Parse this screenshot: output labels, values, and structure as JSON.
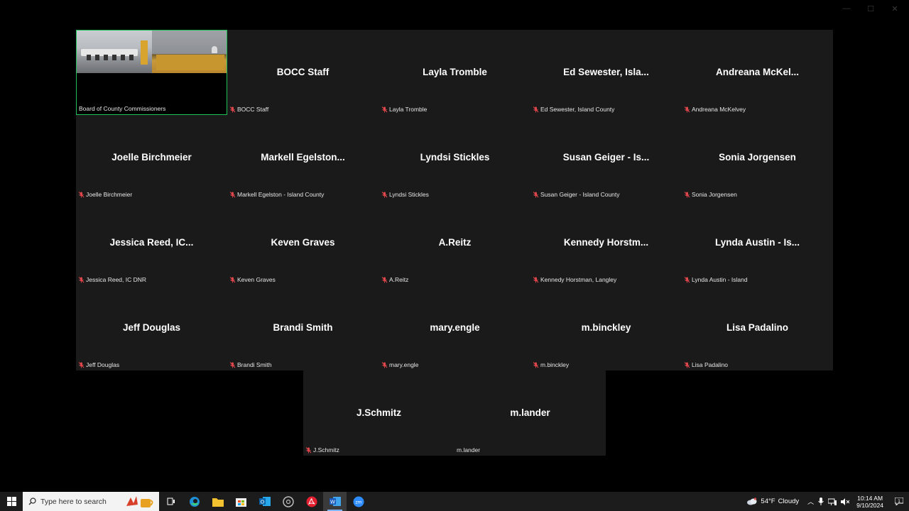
{
  "gallery": {
    "tiles": [
      {
        "name": "",
        "label": "Board of County Commissioners",
        "muted": false,
        "video": true
      },
      {
        "name": "BOCC Staff",
        "label": "BOCC Staff",
        "muted": true
      },
      {
        "name": "Layla Tromble",
        "label": "Layla Tromble",
        "muted": true
      },
      {
        "name": "Ed Sewester, Isla...",
        "label": "Ed Sewester, Island County",
        "muted": true
      },
      {
        "name": "Andreana McKel...",
        "label": "Andreana McKelvey",
        "muted": true
      },
      {
        "name": "Joelle Birchmeier",
        "label": "Joelle Birchmeier",
        "muted": true
      },
      {
        "name": "Markell Egelston...",
        "label": "Markell Egelston - Island County",
        "muted": true
      },
      {
        "name": "Lyndsi Stickles",
        "label": "Lyndsi Stickles",
        "muted": true
      },
      {
        "name": "Susan Geiger - Is...",
        "label": "Susan Geiger - Island County",
        "muted": true
      },
      {
        "name": "Sonia Jorgensen",
        "label": "Sonia Jorgensen",
        "muted": true
      },
      {
        "name": "Jessica Reed, IC...",
        "label": "Jessica Reed, IC DNR",
        "muted": true
      },
      {
        "name": "Keven Graves",
        "label": "Keven Graves",
        "muted": true
      },
      {
        "name": "A.Reitz",
        "label": "A.Reitz",
        "muted": true
      },
      {
        "name": "Kennedy Horstm...",
        "label": "Kennedy Horstman, Langley",
        "muted": true
      },
      {
        "name": "Lynda Austin - Is...",
        "label": "Lynda Austin - Island",
        "muted": true
      },
      {
        "name": "Jeff Douglas",
        "label": "Jeff Douglas",
        "muted": true
      },
      {
        "name": "Brandi Smith",
        "label": "Brandi Smith",
        "muted": true
      },
      {
        "name": "mary.engle",
        "label": "mary.engle",
        "muted": true
      },
      {
        "name": "m.binckley",
        "label": "m.binckley",
        "muted": true
      },
      {
        "name": "Lisa Padalino",
        "label": "Lisa Padalino",
        "muted": true
      }
    ],
    "bottom_tiles": [
      {
        "name": "J.Schmitz",
        "label": "J.Schmitz",
        "muted": true
      },
      {
        "name": "m.lander",
        "label": "m.lander",
        "muted": false
      }
    ]
  },
  "taskbar": {
    "search_placeholder": "Type here to search",
    "apps": [
      {
        "icon": "task-view-icon",
        "active": false
      },
      {
        "icon": "edge-icon",
        "active": false
      },
      {
        "icon": "file-explorer-icon",
        "active": false
      },
      {
        "icon": "store-icon",
        "active": false
      },
      {
        "icon": "outlook-icon",
        "active": false
      },
      {
        "icon": "chrome-icon",
        "active": false
      },
      {
        "icon": "acrobat-icon",
        "active": false
      },
      {
        "icon": "word-icon",
        "active": true
      },
      {
        "icon": "zoom-icon",
        "active": false
      }
    ],
    "weather": {
      "temp": "54°F",
      "condition": "Cloudy"
    },
    "time": "10:14 AM",
    "date": "9/10/2024"
  },
  "colors": {
    "active_speaker_border": "#20c05a",
    "muted_mic": "#e0474c",
    "tile_bg": "#1a1a1a"
  }
}
